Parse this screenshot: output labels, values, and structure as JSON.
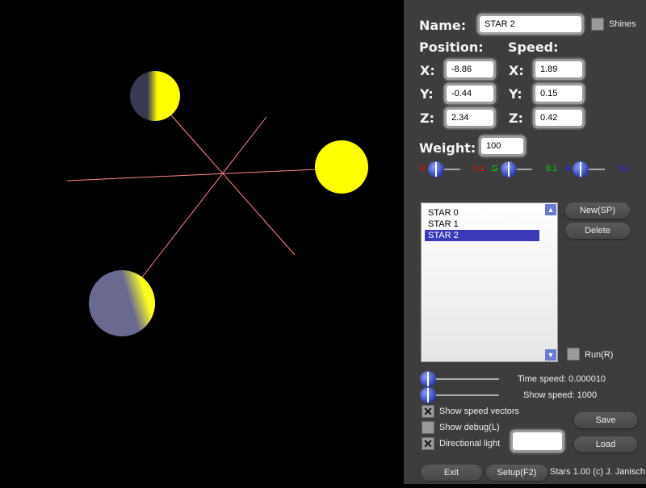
{
  "name_label": "Name:",
  "name_value": "STAR 2",
  "shines_label": "Shines",
  "shines_checked": false,
  "position_label": "Position:",
  "speed_label": "Speed:",
  "x_label": "X:",
  "y_label": "Y:",
  "z_label": "Z:",
  "position": {
    "x": "-8.86",
    "y": "-0.44",
    "z": "2.34"
  },
  "speed": {
    "x": "1.89",
    "y": "0.15",
    "z": "0.42"
  },
  "weight_label": "Weight:",
  "weight_value": "100",
  "color": {
    "r_label": "R",
    "r_value": "0.1",
    "g_label": "G",
    "g_value": "0.1",
    "b_label": "B",
    "b_value": "0.2"
  },
  "stars": [
    "STAR 0",
    "STAR 1",
    "STAR 2"
  ],
  "selected_star": "STAR 2",
  "buttons": {
    "new": "New(SP)",
    "delete": "Delete",
    "run": "Run(R)",
    "save": "Save",
    "load": "Load",
    "exit": "Exit",
    "setup": "Setup(F2)"
  },
  "time_speed": "Time speed: 0.000010",
  "show_speed": "Show speed: 1000",
  "checks": {
    "speed_vectors": "Show speed vectors",
    "debug": "Show debug(L)",
    "directional_light": "Directional light"
  },
  "checked": {
    "speed_vectors": true,
    "debug": false,
    "directional_light": true
  },
  "footer": "Stars 1.00 (c) J. Janisch",
  "colors": {
    "star": "#ffff00",
    "vector": "#ff8080",
    "panel": "#3d3d3d"
  }
}
